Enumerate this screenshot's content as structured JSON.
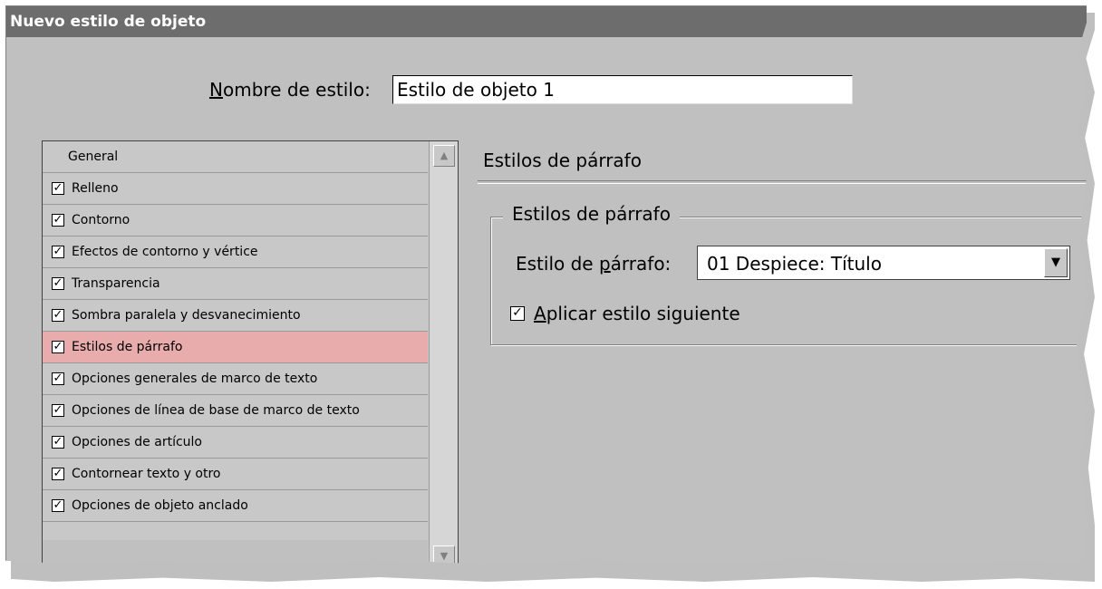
{
  "dialog": {
    "title": "Nuevo estilo de objeto",
    "style_name_label": "Nombre de estilo:",
    "style_name_value": "Estilo de objeto 1"
  },
  "list": {
    "header": "General",
    "items": [
      {
        "label": "Relleno",
        "checked": true
      },
      {
        "label": "Contorno",
        "checked": true
      },
      {
        "label": "Efectos de contorno y vértice",
        "checked": true
      },
      {
        "label": "Transparencia",
        "checked": true
      },
      {
        "label": "Sombra paralela y desvanecimiento",
        "checked": true
      },
      {
        "label": "Estilos de párrafo",
        "checked": true,
        "selected": true
      },
      {
        "label": "Opciones generales de marco de texto",
        "checked": true
      },
      {
        "label": "Opciones de línea de base de marco de texto",
        "checked": true
      },
      {
        "label": "Opciones de artículo",
        "checked": true
      },
      {
        "label": "Contornear texto y otro",
        "checked": true
      },
      {
        "label": "Opciones de objeto anclado",
        "checked": true
      }
    ],
    "selected_color": "#e9acac"
  },
  "panel": {
    "title": "Estilos de párrafo",
    "group_title": "Estilos de párrafo",
    "paragraph_style_label": "Estilo de párrafo:",
    "paragraph_style_value": "01 Despiece: Título",
    "apply_next_label": "Aplicar estilo siguiente",
    "apply_next_checked": true
  },
  "icons": {
    "check": "checkmark-icon",
    "scroll_up": "scroll-up-arrow-icon",
    "scroll_down": "scroll-down-arrow-icon",
    "dropdown": "chevron-down-icon"
  }
}
